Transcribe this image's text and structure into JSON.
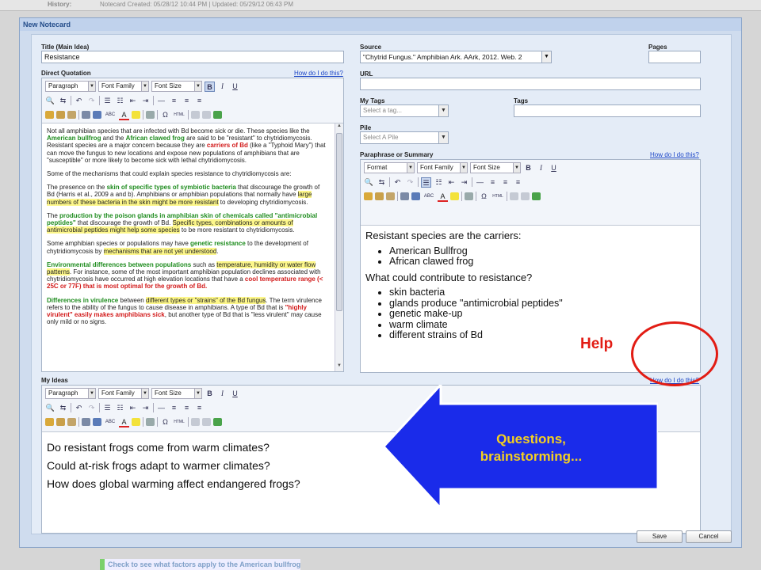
{
  "background": {
    "history_label": "History:",
    "history_value": "Notecard Created: 05/28/12 10:44 PM | Updated: 05/29/12 06:43 PM",
    "bottom_text": "Check to see what factors apply to the American bullfrog"
  },
  "dialog": {
    "title": "New Notecard",
    "title_label": "Title (Main Idea)",
    "title_value": "Resistance",
    "quotation_label": "Direct Quotation",
    "help_link": "How do I do this?",
    "source_label": "Source",
    "source_value": "\"Chytrid Fungus.\" Amphibian Ark. AArk, 2012. Web. 2",
    "pages_label": "Pages",
    "url_label": "URL",
    "my_tags_label": "My Tags",
    "my_tags_placeholder": "Select a tag...",
    "tags_label": "Tags",
    "pile_label": "Pile",
    "pile_placeholder": "Select A Pile",
    "paraphrase_label": "Paraphrase or Summary",
    "ideas_label": "My Ideas",
    "save_label": "Save",
    "cancel_label": "Cancel"
  },
  "toolbar": {
    "paragraph": "Paragraph",
    "format": "Format",
    "font_family": "Font Family",
    "font_size": "Font Size",
    "bold": "B",
    "italic": "I",
    "underline": "U",
    "hr": "—",
    "omega": "Ω",
    "html": "HTML",
    "abc": "ABC"
  },
  "quotation": {
    "p1a": "Not all amphibian species that are infected with Bd become sick or die. These species like the ",
    "p1b": "American bullfrog",
    "p1c": " and the ",
    "p1d": "African clawed frog",
    "p1e": " are said to be \"resistant\" to chytridiomycosis. Resistant species are a major concern because they are ",
    "p1f": "carriers of Bd",
    "p1g": " (like a \"Typhoid Mary\") that can move the fungus to new locations and expose new populations of amphibians that are \"susceptible\" or more likely to become sick with lethal chytridiomycosis.",
    "p2": "Some of the mechanisms that could explain species resistance to chytridiomycosis are:",
    "p3a": "The presence on the ",
    "p3b": "skin of specific types of symbiotic bacteria",
    "p3c": " that discourage the growth of Bd (Harris et al., 2009 a and b). Amphibians or amphibian populations that normally have ",
    "p3d": "large numbers of these bacteria in the skin might be more resistant",
    "p3e": " to developing chytridiomycosis.",
    "p4a": "The ",
    "p4b": "production by the poison glands in amphibian skin of chemicals called \"antimicrobial peptides\"",
    "p4c": " that discourage the growth of Bd. ",
    "p4d": "Specific types, combinations or amounts of antimicrobial peptides might help some species",
    "p4e": " to be more resistant to chytridiomycosis.",
    "p5a": "Some amphibian species or populations may have ",
    "p5b": "genetic resistance",
    "p5c": " to the development of chytridiomycosis by ",
    "p5d": "mechanisms that are not yet understood",
    "p5e": ".",
    "p6a": "Environmental differences between populations",
    "p6b": " such as ",
    "p6c": "temperature, humidity or water flow patterns",
    "p6d": ". For instance, some of the most important amphibian population declines associated with chytridiomycosis have occurred at high elevation locations that have a ",
    "p6e": "cool temperature range (< 25C or 77F) that is most optimal for the growth of Bd.",
    "p7a": "Differences in virulence",
    "p7b": " between ",
    "p7c": "different types or \"strains\" of the Bd fungus",
    "p7d": ". The term virulence refers to the ability of the fungus to cause disease in amphibians. A type of Bd that is ",
    "p7e": "\"highly virulent\" easily makes amphibians sick",
    "p7f": ", but another type of Bd that is \"less virulent\" may cause only mild or no signs."
  },
  "paraphrase": {
    "heading1": "Resistant species are the carriers:",
    "list1": [
      "American Bullfrog",
      "African clawed frog"
    ],
    "heading2": "What could contribute to resistance?",
    "list2": [
      "skin bacteria",
      "glands produce \"antimicrobial peptides\"",
      "genetic make-up",
      "warm climate",
      "different strains of Bd"
    ]
  },
  "ideas": {
    "lines": [
      "Do resistant frogs come from warm climates?",
      "Could at-risk frogs adapt to warmer climates?",
      "How does global warming affect endangered frogs?"
    ]
  },
  "annotations": {
    "help_text": "Help",
    "arrow_text_1": "Questions,",
    "arrow_text_2": "brainstorming...",
    "arrow_color": "#1a2bea",
    "circle_color": "#e21c14",
    "text_color": "#f4d021"
  }
}
